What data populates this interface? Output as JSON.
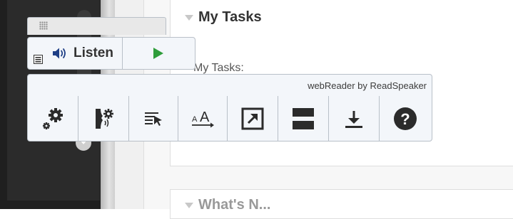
{
  "page": {
    "panel_title": "My Tasks",
    "panel_subtitle": "My Tasks:",
    "second_panel_title": "What's N..."
  },
  "readspeaker": {
    "listen_label": "Listen",
    "brand_text": "webReader by ReadSpeaker",
    "tools": [
      {
        "name": "settings-icon"
      },
      {
        "name": "voice-settings-icon"
      },
      {
        "name": "click-and-listen-icon"
      },
      {
        "name": "text-mode-icon"
      },
      {
        "name": "popup-icon"
      },
      {
        "name": "page-mask-icon"
      },
      {
        "name": "download-icon"
      },
      {
        "name": "help-icon"
      }
    ]
  },
  "colors": {
    "accent_green": "#2e9d3a",
    "icon_dark": "#2b2b2b",
    "toolbar_bg": "#f3f6fa",
    "toolbar_border": "#b9c0c8"
  }
}
